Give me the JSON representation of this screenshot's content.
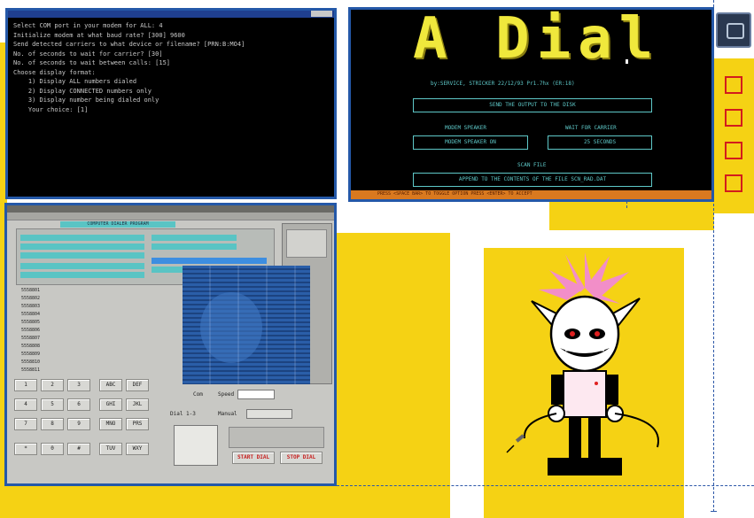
{
  "terminal": {
    "lines": [
      "Select COM port in your modem for ALL: 4",
      "Initialize modem at what baud rate? [300] 9600",
      "Send detected carriers to what device or filename? [PRN:B:MO4]",
      "No. of seconds to wait for carrier? [30]",
      "No. of seconds to wait between calls: [15]",
      "Choose display format:",
      "",
      "    1) Display ALL numbers dialed",
      "    2) Display CONNECTED numbers only",
      "    3) Display number being dialed only",
      "",
      "    Your choice: [1]"
    ]
  },
  "adial": {
    "title": "A Dial",
    "credit": "by:SERVICE, STRICKER 22/12/93 Pr1.7hx (ER:18)",
    "send_output": "SEND THE OUTPUT TO THE DISK",
    "modem_speaker_label": "MODEM SPEAKER",
    "wait_carrier_label": "WAIT FOR CARRIER",
    "modem_speaker_value": "MODEM SPEAKER ON",
    "wait_carrier_value": "25 SECONDS",
    "scan_file_label": "SCAN FILE",
    "append_option": "APPEND TO THE CONTENTS OF THE FILE SCN_RAD.DAT",
    "footer": "PRESS <SPACE BAR> TO TOGGLE OPTION    PRESS <ENTER> TO ACCEPT"
  },
  "dialer_app": {
    "tab_label": "COMPUTER DIALER PROGRAM",
    "list_numbers": [
      "5558801",
      "5558802",
      "5558803",
      "5558804",
      "5558805",
      "5558806",
      "5558807",
      "5558808",
      "5558809",
      "5558810",
      "5558811",
      "5558812",
      "5558813",
      "5558814",
      "5558815"
    ],
    "keys": [
      "1",
      "2",
      "3",
      "ABC",
      "DEF",
      "4",
      "5",
      "6",
      "GHI",
      "JKL",
      "7",
      "8",
      "9",
      "MNO",
      "PRS",
      "*",
      "0",
      "#",
      "TUV",
      "WXY"
    ],
    "start_button": "START DIAL",
    "stop_button": "STOP DIAL",
    "port_label": "Com",
    "speed_label": "Speed",
    "field_label": "Dial 1-3",
    "mode_label": "Manual",
    "accent_teal": "#59c4c4",
    "accent_red": "#c81e1e"
  },
  "colors": {
    "yellow": "#f5d214",
    "window_blue": "#2458a8",
    "terminal_text": "#c8c8c8",
    "dial_yellow": "#f0e83c",
    "dial_cyan": "#5ec8c8"
  }
}
